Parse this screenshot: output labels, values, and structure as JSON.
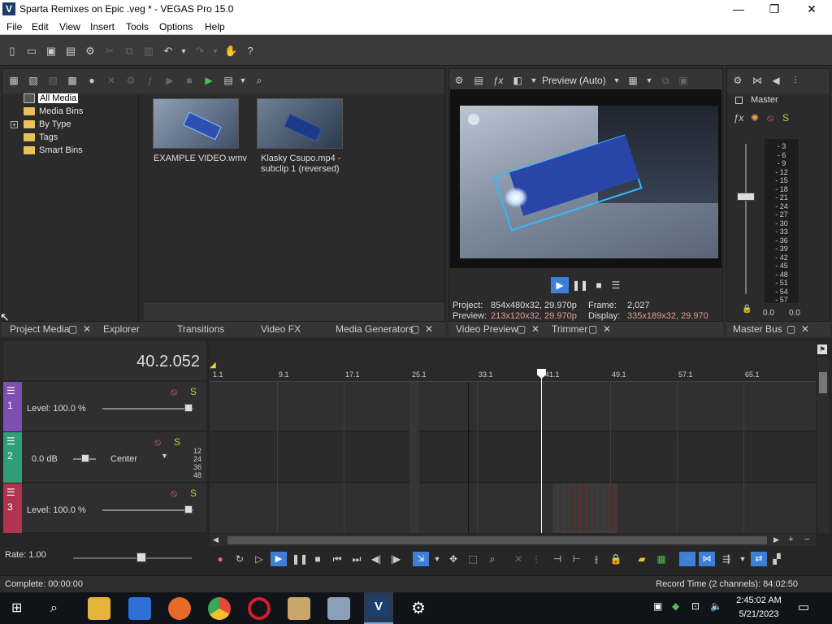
{
  "window": {
    "title": "Sparta Remixes on Epic .veg * - VEGAS Pro 15.0",
    "app_icon_letter": "V"
  },
  "menu": [
    "File",
    "Edit",
    "View",
    "Insert",
    "Tools",
    "Options",
    "Help"
  ],
  "project_media": {
    "tree": [
      "All Media",
      "Media Bins",
      "By Type",
      "Tags",
      "Smart Bins"
    ],
    "media": [
      {
        "label": "EXAMPLE VIDEO.wmv"
      },
      {
        "label": "Klasky Csupo.mp4 - subclip 1 (reversed)"
      }
    ]
  },
  "tabs_left": [
    "Project Media",
    "Explorer",
    "Transitions",
    "Video FX",
    "Media Generators"
  ],
  "preview": {
    "mode": "Preview (Auto)",
    "project_label": "Project:",
    "project_value": "854x480x32, 29.970p",
    "preview_label": "Preview:",
    "preview_value": "213x120x32, 29.970p",
    "frame_label": "Frame:",
    "frame_value": "2,027",
    "display_label": "Display:",
    "display_value": "335x189x32, 29.970"
  },
  "tabs_preview": [
    "Video Preview",
    "Trimmer"
  ],
  "master": {
    "label": "Master",
    "tab": "Master Bus",
    "scale": [
      "3",
      "6",
      "9",
      "12",
      "15",
      "18",
      "21",
      "24",
      "27",
      "30",
      "33",
      "36",
      "39",
      "42",
      "45",
      "48",
      "51",
      "54",
      "57"
    ],
    "left_value": "0.0",
    "right_value": "0.0"
  },
  "timeline": {
    "time": "40.2.052",
    "ruler": [
      "1.1",
      "9.1",
      "17.1",
      "25.1",
      "33.1",
      "41.1",
      "49.1",
      "57.1",
      "65.1"
    ],
    "tracks": [
      {
        "num": "1",
        "color": "#7d4fb0",
        "level": "Level: 100.0 %"
      },
      {
        "num": "2",
        "color": "#2f9e7a",
        "db": "0.0 dB",
        "pan": "Center",
        "meter": [
          "12",
          "24",
          "36",
          "48"
        ]
      },
      {
        "num": "3",
        "color": "#b0344f",
        "level": "Level: 100.0 %"
      }
    ],
    "rate": "Rate: 1.00"
  },
  "status": {
    "left": "Complete: 00:00:00",
    "right": "Record Time (2 channels): 84:02:50"
  },
  "taskbar": {
    "time": "2:45:02 AM",
    "date": "5/21/2023"
  }
}
